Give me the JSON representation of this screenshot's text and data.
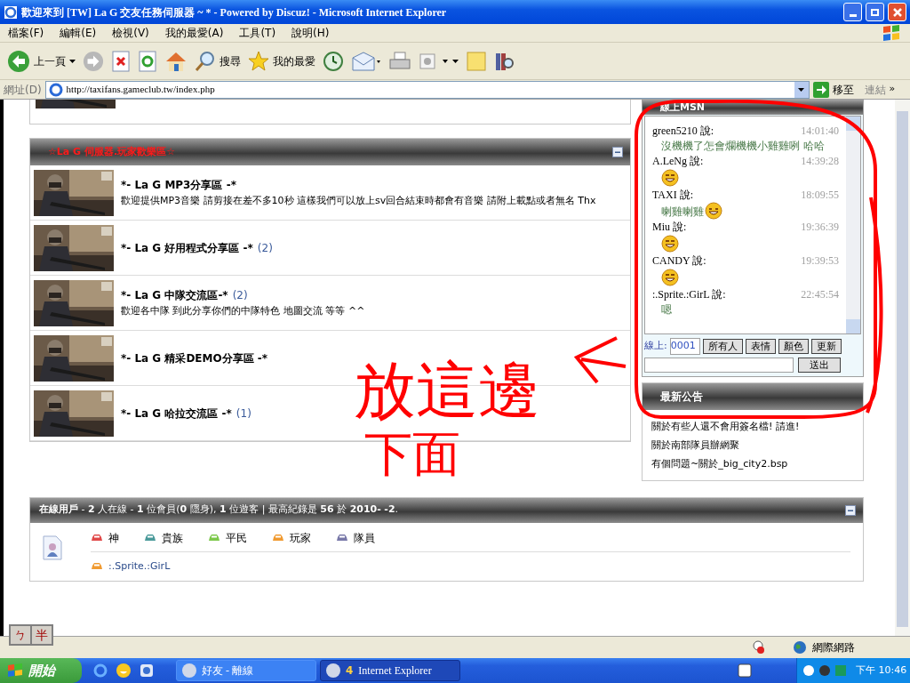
{
  "window": {
    "title": "歡迎來到 [TW] La G 交友任務伺服器 ~ * - Powered by Discuz! - Microsoft Internet Explorer"
  },
  "menu": [
    "檔案(F)",
    "編輯(E)",
    "檢視(V)",
    "我的最愛(A)",
    "工具(T)",
    "說明(H)"
  ],
  "toolbar": [
    {
      "kind": "back",
      "label": "上一頁"
    },
    {
      "kind": "forward"
    },
    {
      "kind": "stop"
    },
    {
      "kind": "refresh"
    },
    {
      "kind": "home"
    },
    {
      "kind": "search",
      "label": "搜尋"
    },
    {
      "kind": "favorites",
      "label": "我的最愛"
    },
    {
      "kind": "history"
    },
    {
      "kind": "mail"
    },
    {
      "kind": "print"
    },
    {
      "kind": "page"
    },
    {
      "kind": "note"
    },
    {
      "kind": "research"
    }
  ],
  "address": {
    "label": "網址(D)",
    "value": "http://taxifans.gameclub.tw/index.php",
    "go": "移至",
    "links": "連結",
    "more": "»"
  },
  "forum": {
    "title": "☆La G 伺服器.玩家歡樂區☆",
    "rows": [
      {
        "title": "*- La G MP3分享區 -*",
        "description": "歡迎提供MP3音樂 請剪接在差不多10秒 這樣我們可以放上sv回合結束時都會有音樂 請附上載點或者無名 Thx"
      },
      {
        "title": "*- La G 好用程式分享區 -*",
        "count": "(2)"
      },
      {
        "title": "*- La G 中隊交流區-*",
        "count": "(2)",
        "description": "歡迎各中隊 到此分享你們的中隊特色 地圖交流 等等 ^^"
      },
      {
        "title": "*- La G 精采DEMO分享區 -*"
      },
      {
        "title": "*- La G 哈拉交流區 -*",
        "count": "(1)"
      }
    ]
  },
  "chat": {
    "title": "線上MSN",
    "messages": [
      {
        "user": "green5210 說:",
        "time": "14:01:40",
        "kind": "text",
        "text": "沒機機了怎會爛機機小雞雞咧 哈哈"
      },
      {
        "user": "A.LeNg 說:",
        "time": "14:39:28",
        "kind": "emoji"
      },
      {
        "user": "TAXI 說:",
        "time": "18:09:55",
        "kind": "text_emoji",
        "text": "喇雞喇雞"
      },
      {
        "user": "Miu 說:",
        "time": "19:36:39",
        "kind": "emoji"
      },
      {
        "user": "CANDY 說:",
        "time": "19:39:53",
        "kind": "emoji"
      },
      {
        "user": ":.Sprite.:GirL 說:",
        "time": "22:45:54",
        "kind": "text",
        "text": "嗯"
      }
    ],
    "online_label": "線上:",
    "online_value": "0001",
    "buttons": [
      "所有人",
      "表情",
      "顏色",
      "更新"
    ],
    "send": "送出"
  },
  "announcements": {
    "title": "最新公告",
    "items": [
      "關於有些人還不會用簽名檔! 請進!",
      "關於南部隊員辦網聚",
      "有個問題~關於_big_city2.bsp"
    ]
  },
  "online": {
    "stats": "**在線用戶** - **2** 人在線 - **1** 位會員(**0** 隱身), **1** 位遊客 | 最高紀錄是 **56** 於 **2010-** **-2**.",
    "legend": [
      {
        "label": "神",
        "color": "#e04848"
      },
      {
        "label": "貴族",
        "color": "#4a9a9a"
      },
      {
        "label": "平民",
        "color": "#7cc84a"
      },
      {
        "label": "玩家",
        "color": "#f09a30"
      },
      {
        "label": "隊員",
        "color": "#7878a8"
      }
    ],
    "users": [
      {
        "name": ":.Sprite.:GirL",
        "color": "#f09a30"
      }
    ]
  },
  "annotation": {
    "lines": [
      "放這邊",
      "下面"
    ]
  },
  "ime": [
    "ㄅ",
    "半"
  ],
  "status": {
    "zone": "網際網路"
  },
  "taskbar": {
    "start": "開始",
    "tasks": [
      {
        "label": "好友 - 離線",
        "selected": false
      },
      {
        "count": "4",
        "label": "Internet Explorer",
        "selected": true
      }
    ],
    "clock": "下午 10:46"
  }
}
